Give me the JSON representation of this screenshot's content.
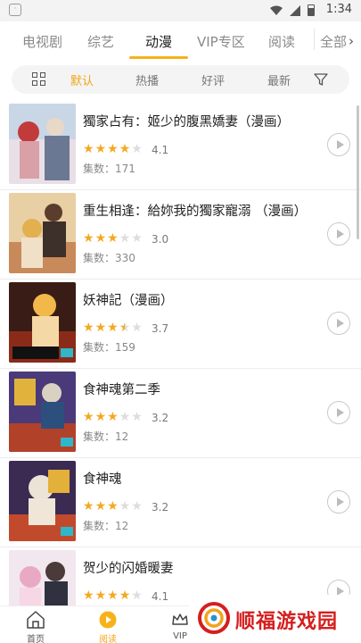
{
  "status_bar": {
    "time": "1:34"
  },
  "tabs": [
    {
      "label": "电视剧"
    },
    {
      "label": "综艺"
    },
    {
      "label": "动漫"
    },
    {
      "label": "VIP专区"
    },
    {
      "label": "阅读"
    }
  ],
  "tabs_all": {
    "label": "全部"
  },
  "filters": [
    {
      "label": "默认"
    },
    {
      "label": "热播"
    },
    {
      "label": "好评"
    },
    {
      "label": "最新"
    }
  ],
  "items": [
    {
      "title": "獨家占有：姬少的腹黑嬌妻（漫画）",
      "score": "4.1",
      "rating": 4.1,
      "episodes": "集数：171"
    },
    {
      "title": "重生相逢：給妳我的獨家寵溺 （漫画）",
      "score": "3.0",
      "rating": 3.0,
      "episodes": "集数：330"
    },
    {
      "title": "妖神記（漫画）",
      "score": "3.7",
      "rating": 3.7,
      "episodes": "集数：159"
    },
    {
      "title": "食神魂第二季",
      "score": "3.2",
      "rating": 3.2,
      "episodes": "集数：12"
    },
    {
      "title": "食神魂",
      "score": "3.2",
      "rating": 3.2,
      "episodes": "集数：12"
    },
    {
      "title": "贺少的闪婚暖妻",
      "score": "4.1",
      "rating": 4.1,
      "episodes": ""
    }
  ],
  "bottom_nav": [
    {
      "label": "首页"
    },
    {
      "label": "阅读"
    },
    {
      "label": "VIP"
    }
  ],
  "watermark": {
    "text": "顺福游戏园"
  },
  "colors": {
    "accent": "#f6b21a",
    "star": "#f3a920",
    "watermark": "#d51e1e"
  }
}
